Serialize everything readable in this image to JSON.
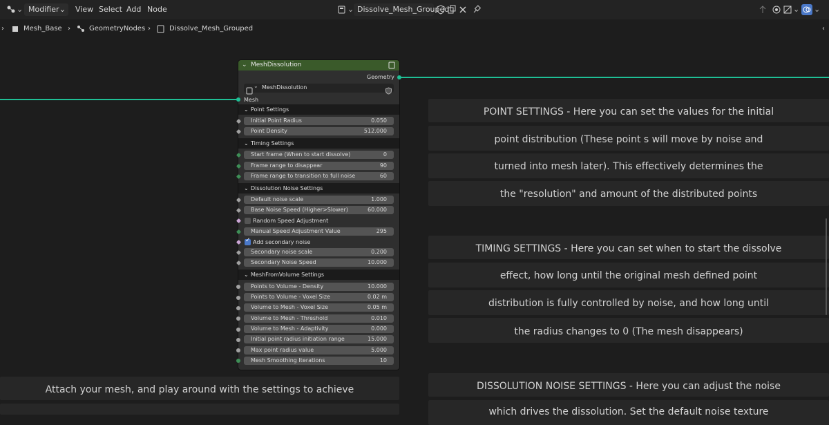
{
  "header": {
    "editor_type_icon": "node-editor-icon",
    "mode": "Modifier",
    "menus": [
      "View",
      "Select",
      "Add",
      "Node"
    ],
    "node_tree_name": "Dissolve_Mesh_Grouped"
  },
  "breadcrumb": {
    "items": [
      "Mesh_Base",
      "GeometryNodes",
      "Dissolve_Mesh_Grouped"
    ]
  },
  "node": {
    "title": "MeshDissolution",
    "output_label": "Geometry",
    "group_name": "MeshDissolution",
    "input_mesh": "Mesh",
    "panels": {
      "point_settings": "Point Settings",
      "timing_settings": "Timing Settings",
      "dissolution_noise_settings": "Dissolution Noise Settings",
      "mesh_from_volume_settings": "MeshFromVolume Settings"
    },
    "fields": {
      "initial_point_radius": {
        "label": "Initial Point Radius",
        "value": "0.050"
      },
      "point_density": {
        "label": "Point Density",
        "value": "512.000"
      },
      "start_frame": {
        "label": "Start frame (When to start dissolve)",
        "value": "0"
      },
      "frame_range_disappear": {
        "label": "Frame range to disappear",
        "value": "90"
      },
      "frame_range_transition": {
        "label": "Frame range to transition to full noise",
        "value": "60"
      },
      "default_noise_scale": {
        "label": "Default noise scale",
        "value": "1.000"
      },
      "base_noise_speed": {
        "label": "Base Noise Speed (Higher>Slower)",
        "value": "60.000"
      },
      "random_speed_adjustment": {
        "label": "Random Speed Adjustment",
        "checked": false
      },
      "manual_speed_adjustment": {
        "label": "Manual Speed Adjustment Value",
        "value": "295"
      },
      "add_secondary_noise": {
        "label": "Add secondary noise",
        "checked": true
      },
      "secondary_noise_scale": {
        "label": "Secondary noise scale",
        "value": "0.200"
      },
      "secondary_noise_speed": {
        "label": "Secondary Noise Speed",
        "value": "10.000"
      },
      "ptv_density": {
        "label": "Points to Volume - Density",
        "value": "10.000"
      },
      "ptv_voxel_size": {
        "label": "Points to Volume - Voxel Size",
        "value": "0.02 m"
      },
      "vtm_voxel_size": {
        "label": "Volume to Mesh - Voxel Size",
        "value": "0.05 m"
      },
      "vtm_threshold": {
        "label": "Volume to Mesh - Threshold",
        "value": "0.010"
      },
      "vtm_adaptivity": {
        "label": "Volume to Mesh - Adaptivity",
        "value": "0.000"
      },
      "initial_radius_range": {
        "label": "Initial point radius initiation range",
        "value": "15.000"
      },
      "max_point_radius": {
        "label": "Max point radius value",
        "value": "5.000"
      },
      "mesh_smoothing": {
        "label": "Mesh Smoothing Iterations",
        "value": "10"
      }
    }
  },
  "notes": {
    "point_settings": [
      "POINT SETTINGS - Here you can set the values for the initial",
      "point distribution (These point s will move by noise and",
      "turned into mesh later). This effectively determines the",
      "the \"resolution\" and amount of the distributed points"
    ],
    "timing_settings": [
      "TIMING SETTINGS - Here you can set when to start the dissolve",
      "effect, how long until the original mesh defined point",
      "distribution is fully controlled by noise, and how long until",
      "the radius changes to 0 (The mesh disappears)"
    ],
    "noise_settings": [
      "DISSOLUTION NOISE SETTINGS - Here you can adjust the noise",
      "which drives the dissolution. Set the default noise texture"
    ],
    "attach_mesh": [
      "Attach your mesh, and play around with the settings to achieve"
    ]
  },
  "colors": {
    "geometry_socket": "#1fbf95",
    "float_socket": "#a1a1a1",
    "int_socket": "#3e8f57",
    "bool_socket": "#cca6d6",
    "node_header": "#3a5a2a"
  }
}
